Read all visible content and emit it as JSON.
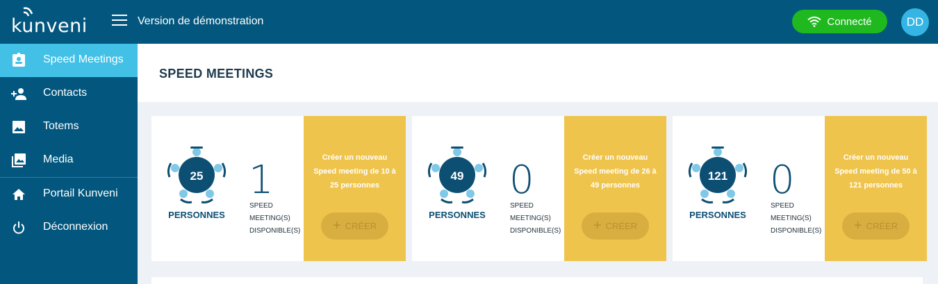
{
  "header": {
    "logo_text": "kunveni",
    "app_title": "Version de démonstration",
    "status_label": "Connecté",
    "avatar_initials": "DD",
    "status_color": "#1fb91f",
    "brand_color": "#03577e"
  },
  "sidebar": {
    "items": [
      {
        "label": "Speed Meetings",
        "icon": "badge-icon",
        "active": true
      },
      {
        "label": "Contacts",
        "icon": "add-person-icon"
      },
      {
        "label": "Totems",
        "icon": "image-icon"
      },
      {
        "label": "Media",
        "icon": "gallery-icon"
      },
      {
        "label": "Portail Kunveni",
        "icon": "home-icon"
      },
      {
        "label": "Déconnexion",
        "icon": "power-icon"
      }
    ]
  },
  "main": {
    "page_title": "SPEED MEETINGS",
    "cards": [
      {
        "capacity": "25",
        "persons_label": "PERSONNES",
        "count": "1",
        "avail_lines": [
          "SPEED",
          "MEETING(S)",
          "DISPONIBLE(S)"
        ],
        "action_lines": [
          "Créer un nouveau",
          "Speed meeting de 10 à",
          "25 personnes"
        ],
        "button_label": "CRÉER"
      },
      {
        "capacity": "49",
        "persons_label": "PERSONNES",
        "count": "0",
        "avail_lines": [
          "SPEED",
          "MEETING(S)",
          "DISPONIBLE(S)"
        ],
        "action_lines": [
          "Créer un nouveau",
          "Speed meeting de 26 à",
          "49 personnes"
        ],
        "button_label": "CRÉER"
      },
      {
        "capacity": "121",
        "persons_label": "PERSONNES",
        "count": "0",
        "avail_lines": [
          "SPEED",
          "MEETING(S)",
          "DISPONIBLE(S)"
        ],
        "action_lines": [
          "Créer un nouveau",
          "Speed meeting de 50 à",
          "121 personnes"
        ],
        "button_label": "CRÉER"
      }
    ]
  }
}
